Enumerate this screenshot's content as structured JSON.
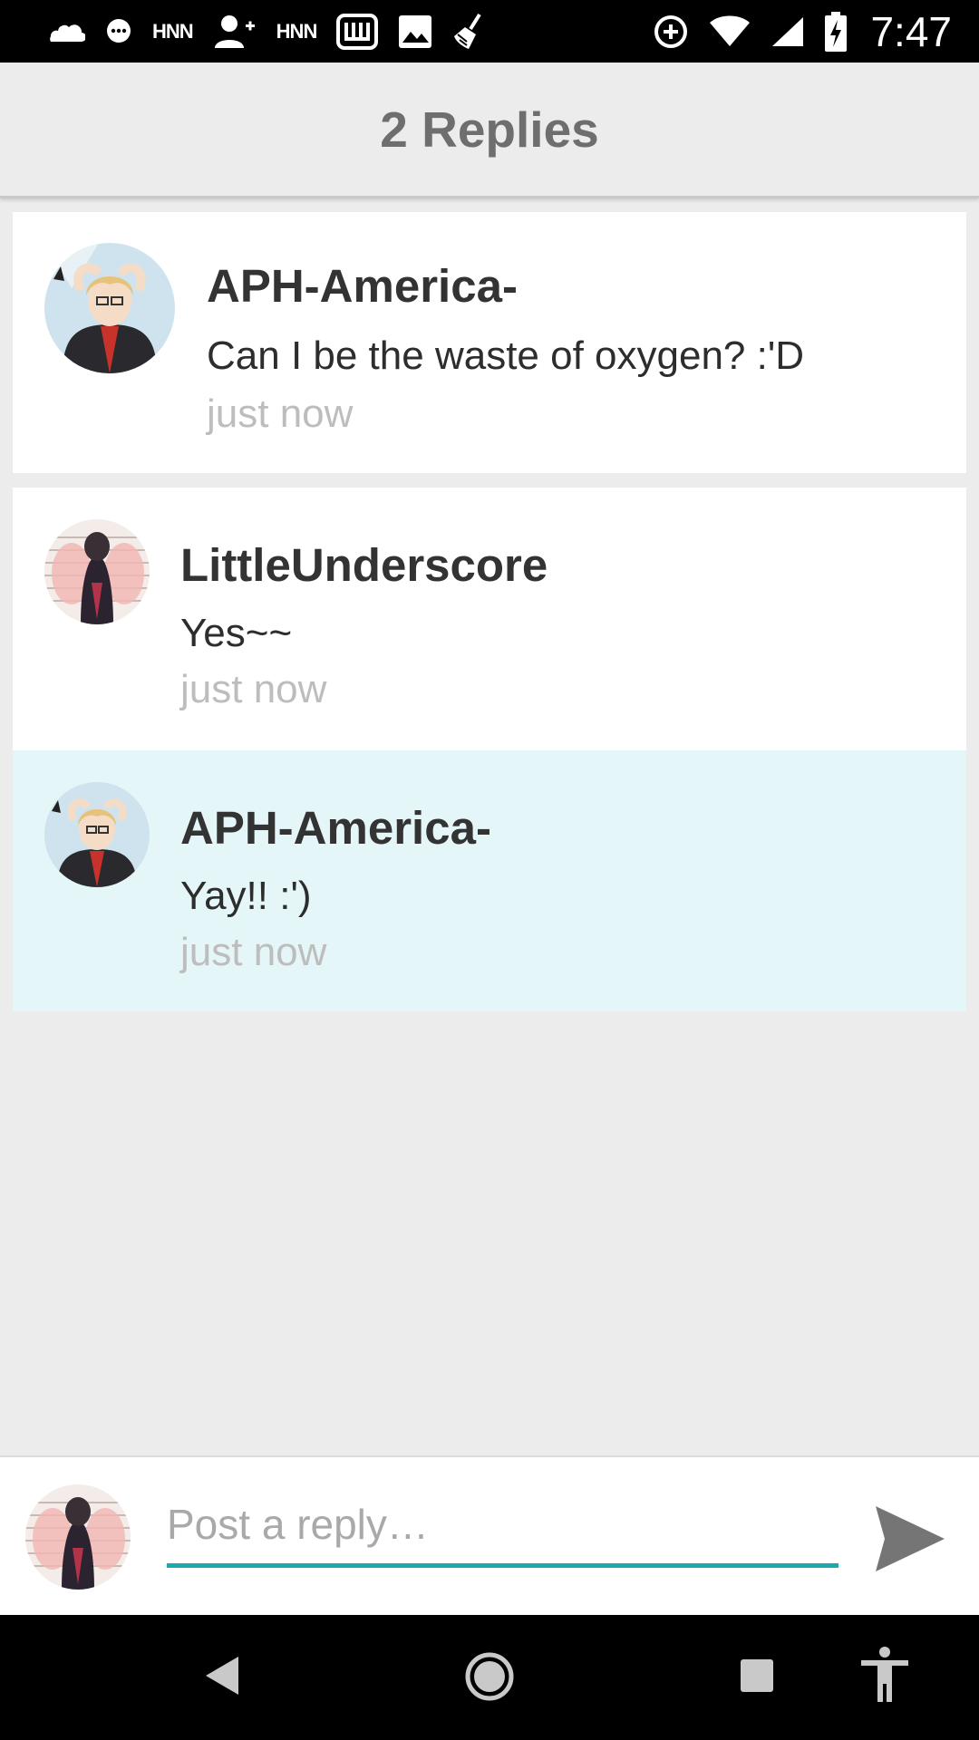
{
  "status_bar": {
    "time": "7:47",
    "notif_label_1": "HNN",
    "notif_label_2": "HNN",
    "icons": [
      "cloud-icon",
      "chat-bubble-icon",
      "add-person-icon",
      "w-app-icon",
      "image-icon",
      "broom-icon",
      "data-saver-icon",
      "wifi-icon",
      "signal-icon",
      "battery-charging-icon"
    ]
  },
  "header": {
    "title": "2 Replies"
  },
  "replies": [
    {
      "author": "APH-America-",
      "message": "Can I be the waste of oxygen?  :'D",
      "time": "just now"
    },
    {
      "author": "LittleUnderscore",
      "message": "Yes~~",
      "time": "just now"
    },
    {
      "author": "APH-America-",
      "message": "Yay!!  :')",
      "time": "just now"
    }
  ],
  "composer": {
    "placeholder": "Post a reply…",
    "send_icon": "send-icon"
  },
  "nav_bar": {
    "icons": [
      "back-icon",
      "home-icon",
      "recents-icon",
      "accessibility-icon"
    ]
  },
  "colors": {
    "accent": "#1aa9b0",
    "highlight_row": "#e4f6f7",
    "background": "#ececec"
  }
}
